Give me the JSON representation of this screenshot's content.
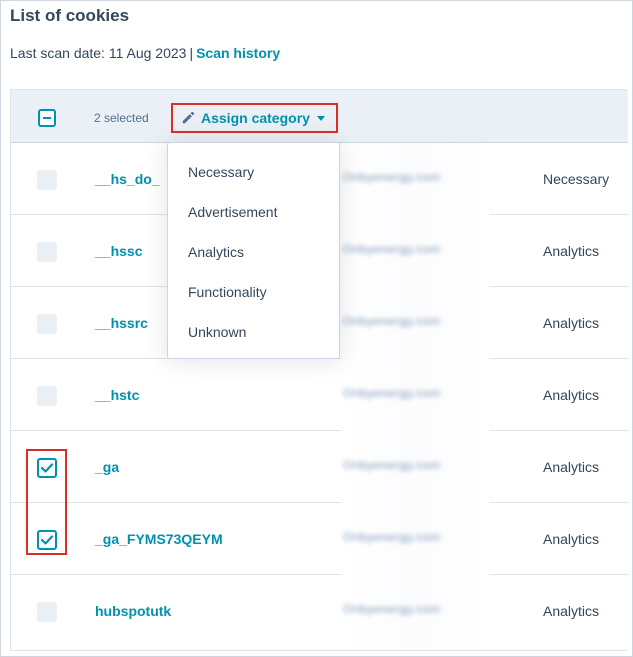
{
  "page": {
    "title": "List of cookies",
    "scan_label": "Last scan date: 11 Aug 2023",
    "separator": "|",
    "scan_history_link": "Scan history"
  },
  "toolbar": {
    "selected_count": "2 selected",
    "assign_label": "Assign category"
  },
  "dropdown": {
    "items": [
      "Necessary",
      "Advertisement",
      "Analytics",
      "Functionality",
      "Unknown"
    ]
  },
  "rows": [
    {
      "name": "__hs_do_",
      "domain": "Onbyenergy.com",
      "category": "Necessary",
      "checked": false
    },
    {
      "name": "__hssc",
      "domain": "Onbyenergy.com",
      "category": "Analytics",
      "checked": false
    },
    {
      "name": "__hssrc",
      "domain": "Onbyenergy.com",
      "category": "Analytics",
      "checked": false
    },
    {
      "name": "__hstc",
      "domain": "Onbyenergy.com",
      "category": "Analytics",
      "checked": false
    },
    {
      "name": "_ga",
      "domain": "Onbyenergy.com",
      "category": "Analytics",
      "checked": true
    },
    {
      "name": "_ga_FYMS73QEYM",
      "domain": "Onbyenergy.com",
      "category": "Analytics",
      "checked": true
    },
    {
      "name": "hubspotutk",
      "domain": "Onbyenergy.com",
      "category": "Analytics",
      "checked": false
    }
  ],
  "colors": {
    "accent": "#0091ae",
    "highlight": "#d93025",
    "text": "#33475b",
    "header_bg": "#eaf0f6"
  },
  "icons": {
    "edit": "pencil-icon",
    "caret": "caret-down-icon",
    "checkbox_checked": "checkmark-icon",
    "checkbox_indeterminate": "minus-icon"
  }
}
